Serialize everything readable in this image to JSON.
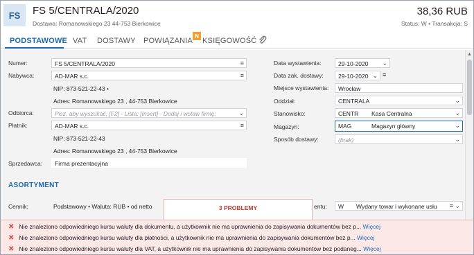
{
  "header": {
    "logo": "FS",
    "title": "FS 5/CENTRALA/2020",
    "delivery": "Dostawa: Romanowskiego 23  44-753 Bierkowice",
    "amount": "38,36 RUB",
    "status": "Status: W  •  Transakcja: S"
  },
  "tabs": {
    "basic": "PODSTAWOWE",
    "vat": "VAT",
    "deliveries": "DOSTAWY",
    "relations": "POWIĄZANIA",
    "relations_badge": "N",
    "accounting": "KSIĘGOWOŚĆ",
    "attachment_icon": "paperclip-icon"
  },
  "left": {
    "number_label": "Numer:",
    "number_value": "FS 5/CENTRALA/2020",
    "buyer_label": "Nabywca:",
    "buyer_value": "AD-MAR s.c.",
    "buyer_nip": "NIP:  873-521-22-43  •",
    "buyer_address": "Adres:  Romanowskiego 23 , 44-753 Bierkowice",
    "recipient_label": "Odbiorca:",
    "recipient_placeholder": "Pisz, aby wyszukać; [F2] - Lista; [Insert] - Dodaj i wstaw firmę;",
    "payer_label": "Płatnik:",
    "payer_value": "AD-MAR s.c.",
    "payer_nip": "NIP:  873-521-22-43",
    "payer_address": "Adres:  Romanowskiego 23 , 44-753 Bierkowice",
    "seller_label": "Sprzedawca:",
    "seller_value": "Firma prezentacyjna"
  },
  "right": {
    "issue_date_label": "Data wystawienia:",
    "issue_date_value": "29-10-2020",
    "purchase_date_label": "Data zak. dostawy:",
    "purchase_date_value": "29-10-2020",
    "place_label": "Miejsce wystawienia:",
    "place_value": "Wrocław",
    "branch_label": "Oddział:",
    "branch_value": "CENTRALA",
    "station_label": "Stanowisko:",
    "station_code": "CENTR",
    "station_name": "Kasa Centralna",
    "warehouse_label": "Magazyn:",
    "warehouse_code": "MAG",
    "warehouse_name": "Magazyn główny",
    "delivery_method_label": "Sposób dostawy:",
    "delivery_method_value": "(brak)"
  },
  "assortment": {
    "title": "ASORTYMENT",
    "pricelist_label": "Cennik:",
    "pricelist_value": "Podstawowy • Waluta: RUB • od netto",
    "issue_label_partial": "entu:",
    "issue_code": "W",
    "issue_value": "Wydany towar i wykonane usłu"
  },
  "problems": {
    "title": "3 PROBLEMY",
    "more": "Więcej",
    "items": [
      "Nie znaleziono odpowiedniego kursu waluty dla dokumentu, a użytkownik nie ma uprawnienia do zapisywania dokumentów bez p...",
      "Nie znaleziono odpowiedniego kursu waluty dla płatności, a użytkownik nie ma uprawnienia do zapisywania dokumentów bez p...",
      "Nie znaleziono odpowiedniego kursu waluty dla VAT, a użytkownik nie ma uprawnienia do zapisywania dokumentów bez podaneg..."
    ]
  },
  "colors": {
    "accent": "#1b6ab3",
    "error": "#d9342b",
    "badge": "#f0a030"
  }
}
